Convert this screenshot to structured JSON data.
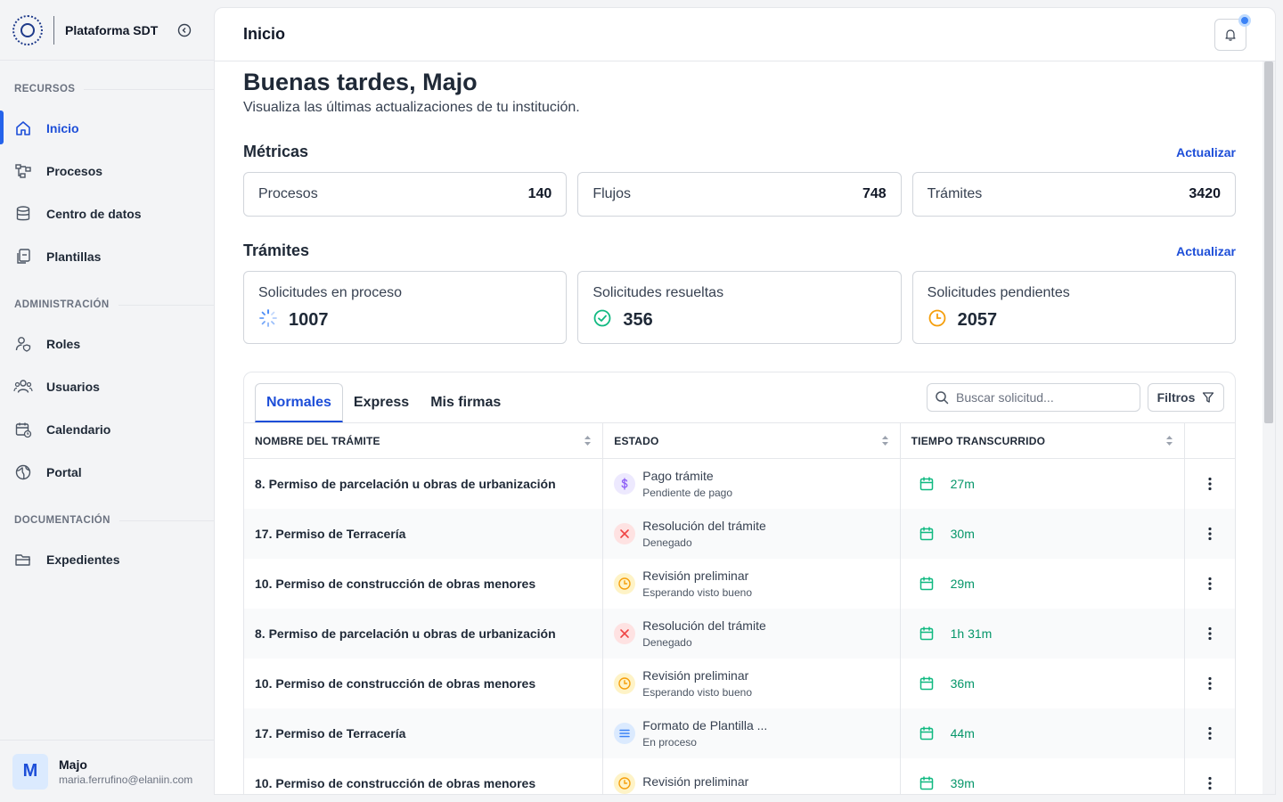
{
  "app": {
    "title": "Plataforma SDT"
  },
  "sidebar": {
    "sections": [
      {
        "label": "RECURSOS"
      },
      {
        "label": "ADMINISTRACIÓN"
      },
      {
        "label": "DOCUMENTACIÓN"
      }
    ],
    "items": [
      {
        "label": "Inicio",
        "icon": "home-icon",
        "active": true
      },
      {
        "label": "Procesos",
        "icon": "flow-icon"
      },
      {
        "label": "Centro de datos",
        "icon": "database-icon"
      },
      {
        "label": "Plantillas",
        "icon": "templates-icon"
      },
      {
        "label": "Roles",
        "icon": "user-shield-icon"
      },
      {
        "label": "Usuarios",
        "icon": "users-icon"
      },
      {
        "label": "Calendario",
        "icon": "calendar-clock-icon"
      },
      {
        "label": "Portal",
        "icon": "globe-icon"
      },
      {
        "label": "Expedientes",
        "icon": "folder-icon"
      }
    ]
  },
  "user": {
    "initial": "M",
    "name": "Majo",
    "email": "maria.ferrufino@elaniin.com"
  },
  "topbar": {
    "title": "Inicio"
  },
  "greeting": {
    "title": "Buenas tardes, Majo",
    "subtitle": "Visualiza las últimas actualizaciones de tu institución."
  },
  "metricas": {
    "title": "Métricas",
    "refresh": "Actualizar",
    "cards": [
      {
        "label": "Procesos",
        "value": "140"
      },
      {
        "label": "Flujos",
        "value": "748"
      },
      {
        "label": "Trámites",
        "value": "3420"
      }
    ]
  },
  "tramites": {
    "title": "Trámites",
    "refresh": "Actualizar",
    "cards": [
      {
        "label": "Solicitudes en proceso",
        "value": "1007",
        "icon": "spinner-icon"
      },
      {
        "label": "Solicitudes resueltas",
        "value": "356",
        "icon": "check-circle-icon"
      },
      {
        "label": "Solicitudes pendientes",
        "value": "2057",
        "icon": "clock-icon"
      }
    ]
  },
  "table": {
    "tabs": [
      {
        "label": "Normales"
      },
      {
        "label": "Express"
      },
      {
        "label": "Mis firmas"
      }
    ],
    "search_placeholder": "Buscar solicitud...",
    "filters_label": "Filtros",
    "columns": [
      "NOMBRE DEL TRÁMITE",
      "ESTADO",
      "TIEMPO TRANSCURRIDO"
    ],
    "rows": [
      {
        "name": "8. Permiso de parcelación u obras de urbanización",
        "status": "Pago trámite",
        "substatus": "Pendiente de pago",
        "status_icon": "dollar-icon",
        "time": "27m"
      },
      {
        "name": "17. Permiso de Terracería",
        "status": "Resolución del trámite",
        "substatus": "Denegado",
        "status_icon": "x-icon",
        "time": "30m"
      },
      {
        "name": "10. Permiso de construcción de obras menores",
        "status": "Revisión preliminar",
        "substatus": "Esperando visto bueno",
        "status_icon": "clock-icon",
        "time": "29m"
      },
      {
        "name": "8. Permiso de parcelación u obras de urbanización",
        "status": "Resolución del trámite",
        "substatus": "Denegado",
        "status_icon": "x-icon",
        "time": "1h 31m"
      },
      {
        "name": "10. Permiso de construcción de obras menores",
        "status": "Revisión preliminar",
        "substatus": "Esperando visto bueno",
        "status_icon": "clock-icon",
        "time": "36m"
      },
      {
        "name": "17. Permiso de Terracería",
        "status": "Formato de Plantilla ...",
        "substatus": "En proceso",
        "status_icon": "list-icon",
        "time": "44m"
      },
      {
        "name": "10. Permiso de construcción de obras menores",
        "status": "Revisión preliminar",
        "substatus": "",
        "status_icon": "clock-icon",
        "time": "39m"
      }
    ]
  },
  "colors": {
    "primary": "#1d4ed8",
    "success": "#059669",
    "danger": "#ef4444",
    "warning": "#f59e0b",
    "purple": "#8b5cf6"
  }
}
